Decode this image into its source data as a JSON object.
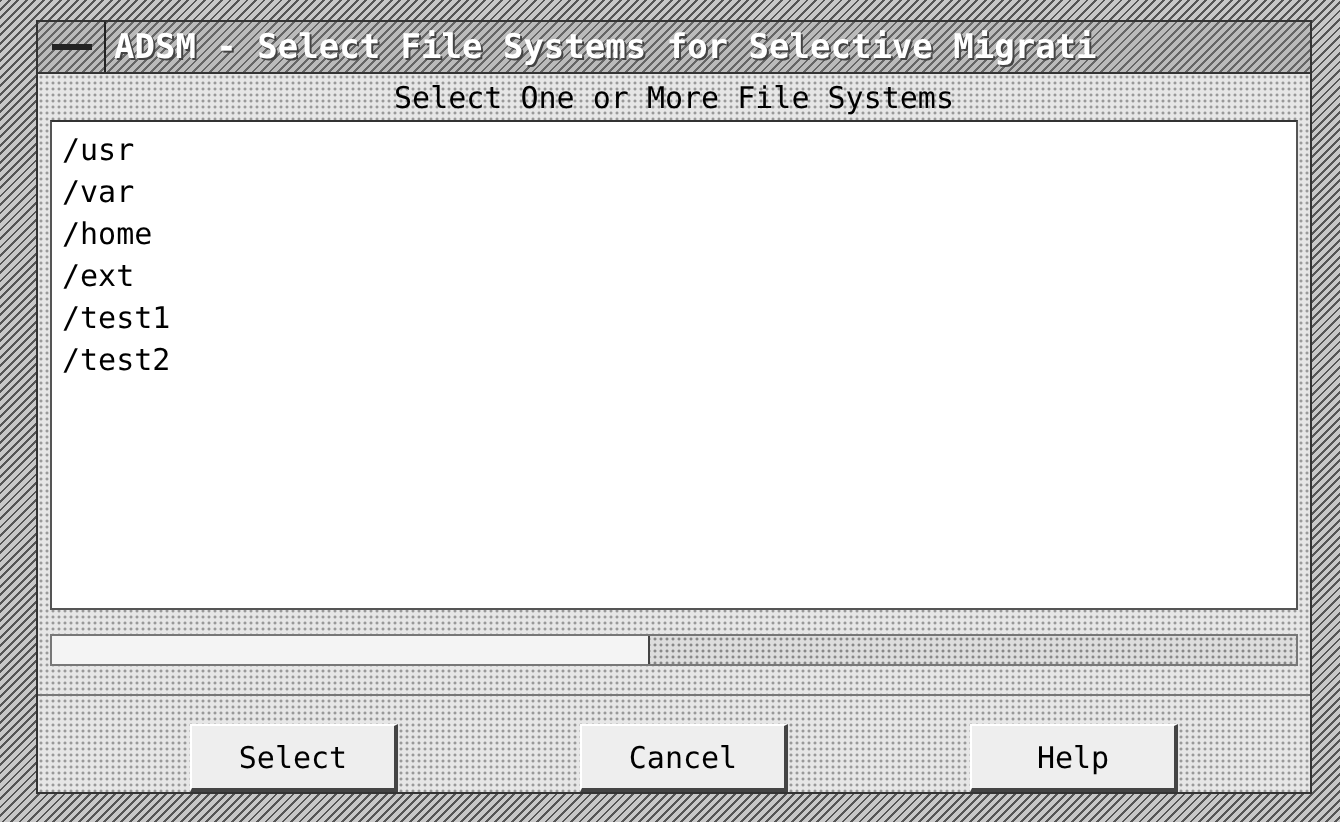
{
  "window": {
    "title": "ADSM - Select File Systems for Selective Migrati"
  },
  "heading": "Select One or More File Systems",
  "file_systems": [
    {
      "path": "/usr",
      "selected": false
    },
    {
      "path": "/var",
      "selected": false
    },
    {
      "path": "/home",
      "selected": false
    },
    {
      "path": "/ext",
      "selected": false
    },
    {
      "path": "/test1",
      "selected": false
    },
    {
      "path": "/test2",
      "selected": false
    }
  ],
  "buttons": [
    "Select",
    "Cancel",
    "Help"
  ]
}
